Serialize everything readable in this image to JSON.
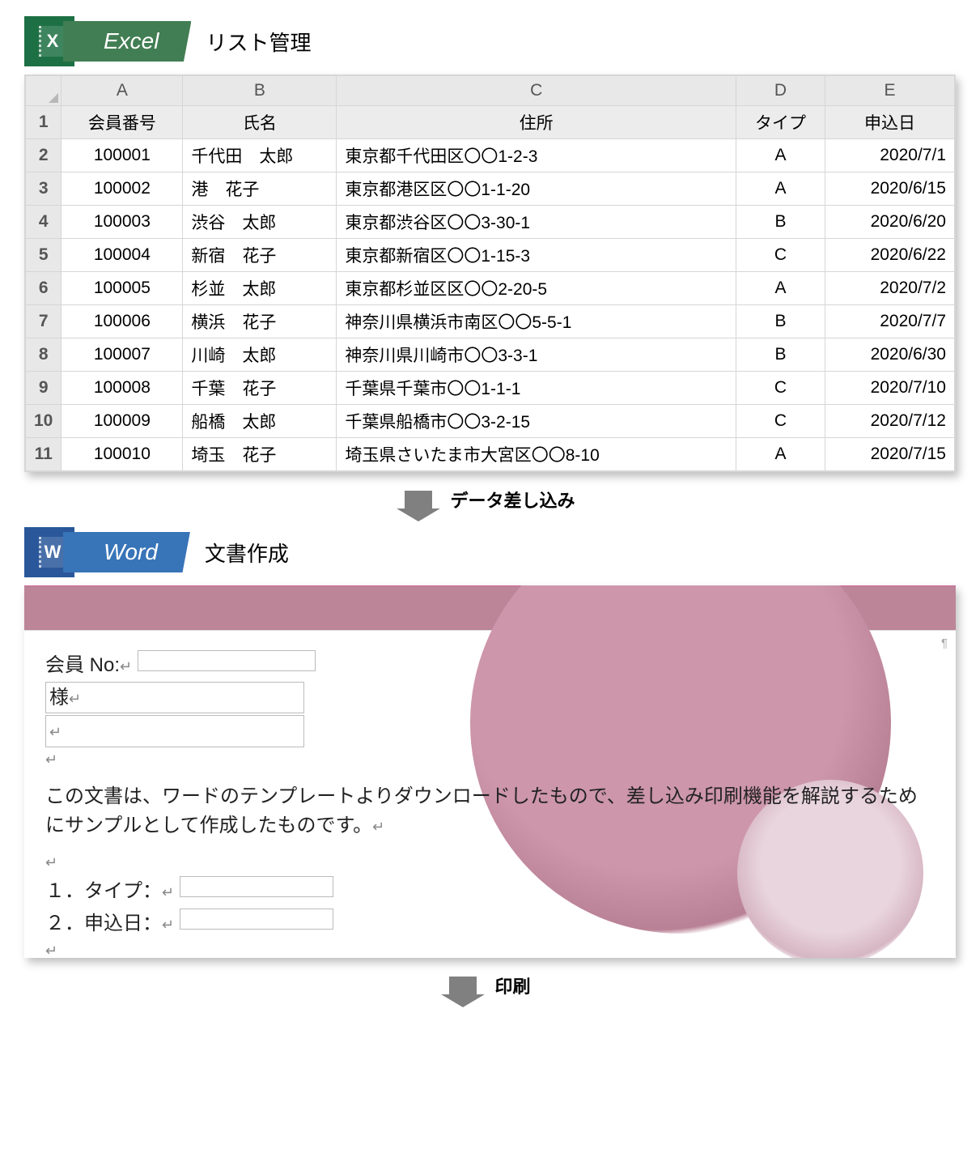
{
  "excel": {
    "app_name": "Excel",
    "app_letter": "X",
    "section_title": "リスト管理",
    "columns_letters": [
      "A",
      "B",
      "C",
      "D",
      "E"
    ],
    "headers": {
      "member_no": "会員番号",
      "name": "氏名",
      "address": "住所",
      "type": "タイプ",
      "date": "申込日"
    },
    "rows": [
      {
        "n": "2",
        "member_no": "100001",
        "name": "千代田　太郎",
        "address": "東京都千代田区〇〇1-2-3",
        "type": "A",
        "date": "2020/7/1"
      },
      {
        "n": "3",
        "member_no": "100002",
        "name": "港　花子",
        "address": "東京都港区区〇〇1-1-20",
        "type": "A",
        "date": "2020/6/15"
      },
      {
        "n": "4",
        "member_no": "100003",
        "name": "渋谷　太郎",
        "address": "東京都渋谷区〇〇3-30-1",
        "type": "B",
        "date": "2020/6/20"
      },
      {
        "n": "5",
        "member_no": "100004",
        "name": "新宿　花子",
        "address": "東京都新宿区〇〇1-15-3",
        "type": "C",
        "date": "2020/6/22"
      },
      {
        "n": "6",
        "member_no": "100005",
        "name": "杉並　太郎",
        "address": "東京都杉並区区〇〇2-20-5",
        "type": "A",
        "date": "2020/7/2"
      },
      {
        "n": "7",
        "member_no": "100006",
        "name": "横浜　花子",
        "address": "神奈川県横浜市南区〇〇5-5-1",
        "type": "B",
        "date": "2020/7/7"
      },
      {
        "n": "8",
        "member_no": "100007",
        "name": "川崎　太郎",
        "address": "神奈川県川崎市〇〇3-3-1",
        "type": "B",
        "date": "2020/6/30"
      },
      {
        "n": "9",
        "member_no": "100008",
        "name": "千葉　花子",
        "address": "千葉県千葉市〇〇1-1-1",
        "type": "C",
        "date": "2020/7/10"
      },
      {
        "n": "10",
        "member_no": "100009",
        "name": "船橋　太郎",
        "address": "千葉県船橋市〇〇3-2-15",
        "type": "C",
        "date": "2020/7/12"
      },
      {
        "n": "11",
        "member_no": "100010",
        "name": "埼玉　花子",
        "address": "埼玉県さいたま市大宮区〇〇8-10",
        "type": "A",
        "date": "2020/7/15"
      }
    ],
    "header_row_num": "1"
  },
  "arrow1": "データ差し込み",
  "arrow2": "印刷",
  "word": {
    "app_name": "Word",
    "app_letter": "W",
    "section_title": "文書作成",
    "member_label": "会員 No:",
    "sama": "様",
    "body": "この文書は、ワードのテンプレートよりダウンロードしたもので、差し込み印刷機能を解説するためにサンプルとして作成したものです。",
    "line1": "１．タイプ：",
    "line2": "２．申込日：",
    "ret": "↵"
  }
}
